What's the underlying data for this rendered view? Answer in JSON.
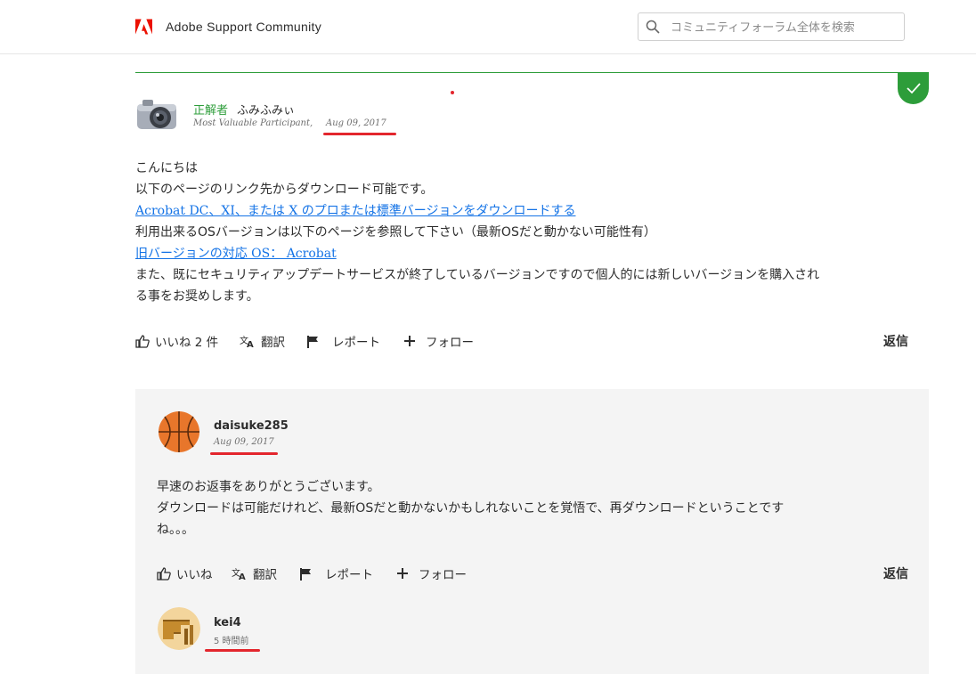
{
  "header": {
    "brand": "Adobe Support Community",
    "search_placeholder": "コミュニティフォーラム全体を検索"
  },
  "accepted_post": {
    "badge_label": "正解者",
    "author": "ふみふみぃ",
    "rank": "Most Valuable Participant,",
    "date": "Aug 09, 2017",
    "lines": [
      "こんにちは",
      "以下のページのリンク先からダウンロード可能です。"
    ],
    "link1": "Acrobat DC、XI、または X のプロまたは標準バージョンをダウンロードする",
    "line3": "利用出来るOSバージョンは以下のページを参照して下さい（最新OSだと動かない可能性有）",
    "link2": "旧バージョンの対応 OS： Acrobat",
    "line4": "また、既にセキュリティアップデートサービスが終了しているバージョンですので個人的には新しいバージョンを購入され",
    "line5": "る事をお奨めします。",
    "actions": {
      "like": "いいね 2 件",
      "translate": "翻訳",
      "report": "レポート",
      "follow": "フォロー",
      "reply": "返信"
    }
  },
  "reply_post": {
    "author": "daisuke285",
    "date": "Aug 09, 2017",
    "line1": "早速のお返事をありがとうございます。",
    "line2": "ダウンロードは可能だけれど、最新OSだと動かないかもしれないことを覚悟で、再ダウンロードということです",
    "line3": "ね。。。",
    "actions": {
      "like": "いいね",
      "translate": "翻訳",
      "report": "レポート",
      "follow": "フォロー",
      "reply": "返信"
    }
  },
  "nested_reply": {
    "author": "kei4",
    "time": "5 時間前"
  },
  "colors": {
    "accent_green": "#2d9d3a",
    "link_blue": "#1473e6",
    "annotation_red": "#e3262d",
    "adobe_red": "#eb1000"
  }
}
